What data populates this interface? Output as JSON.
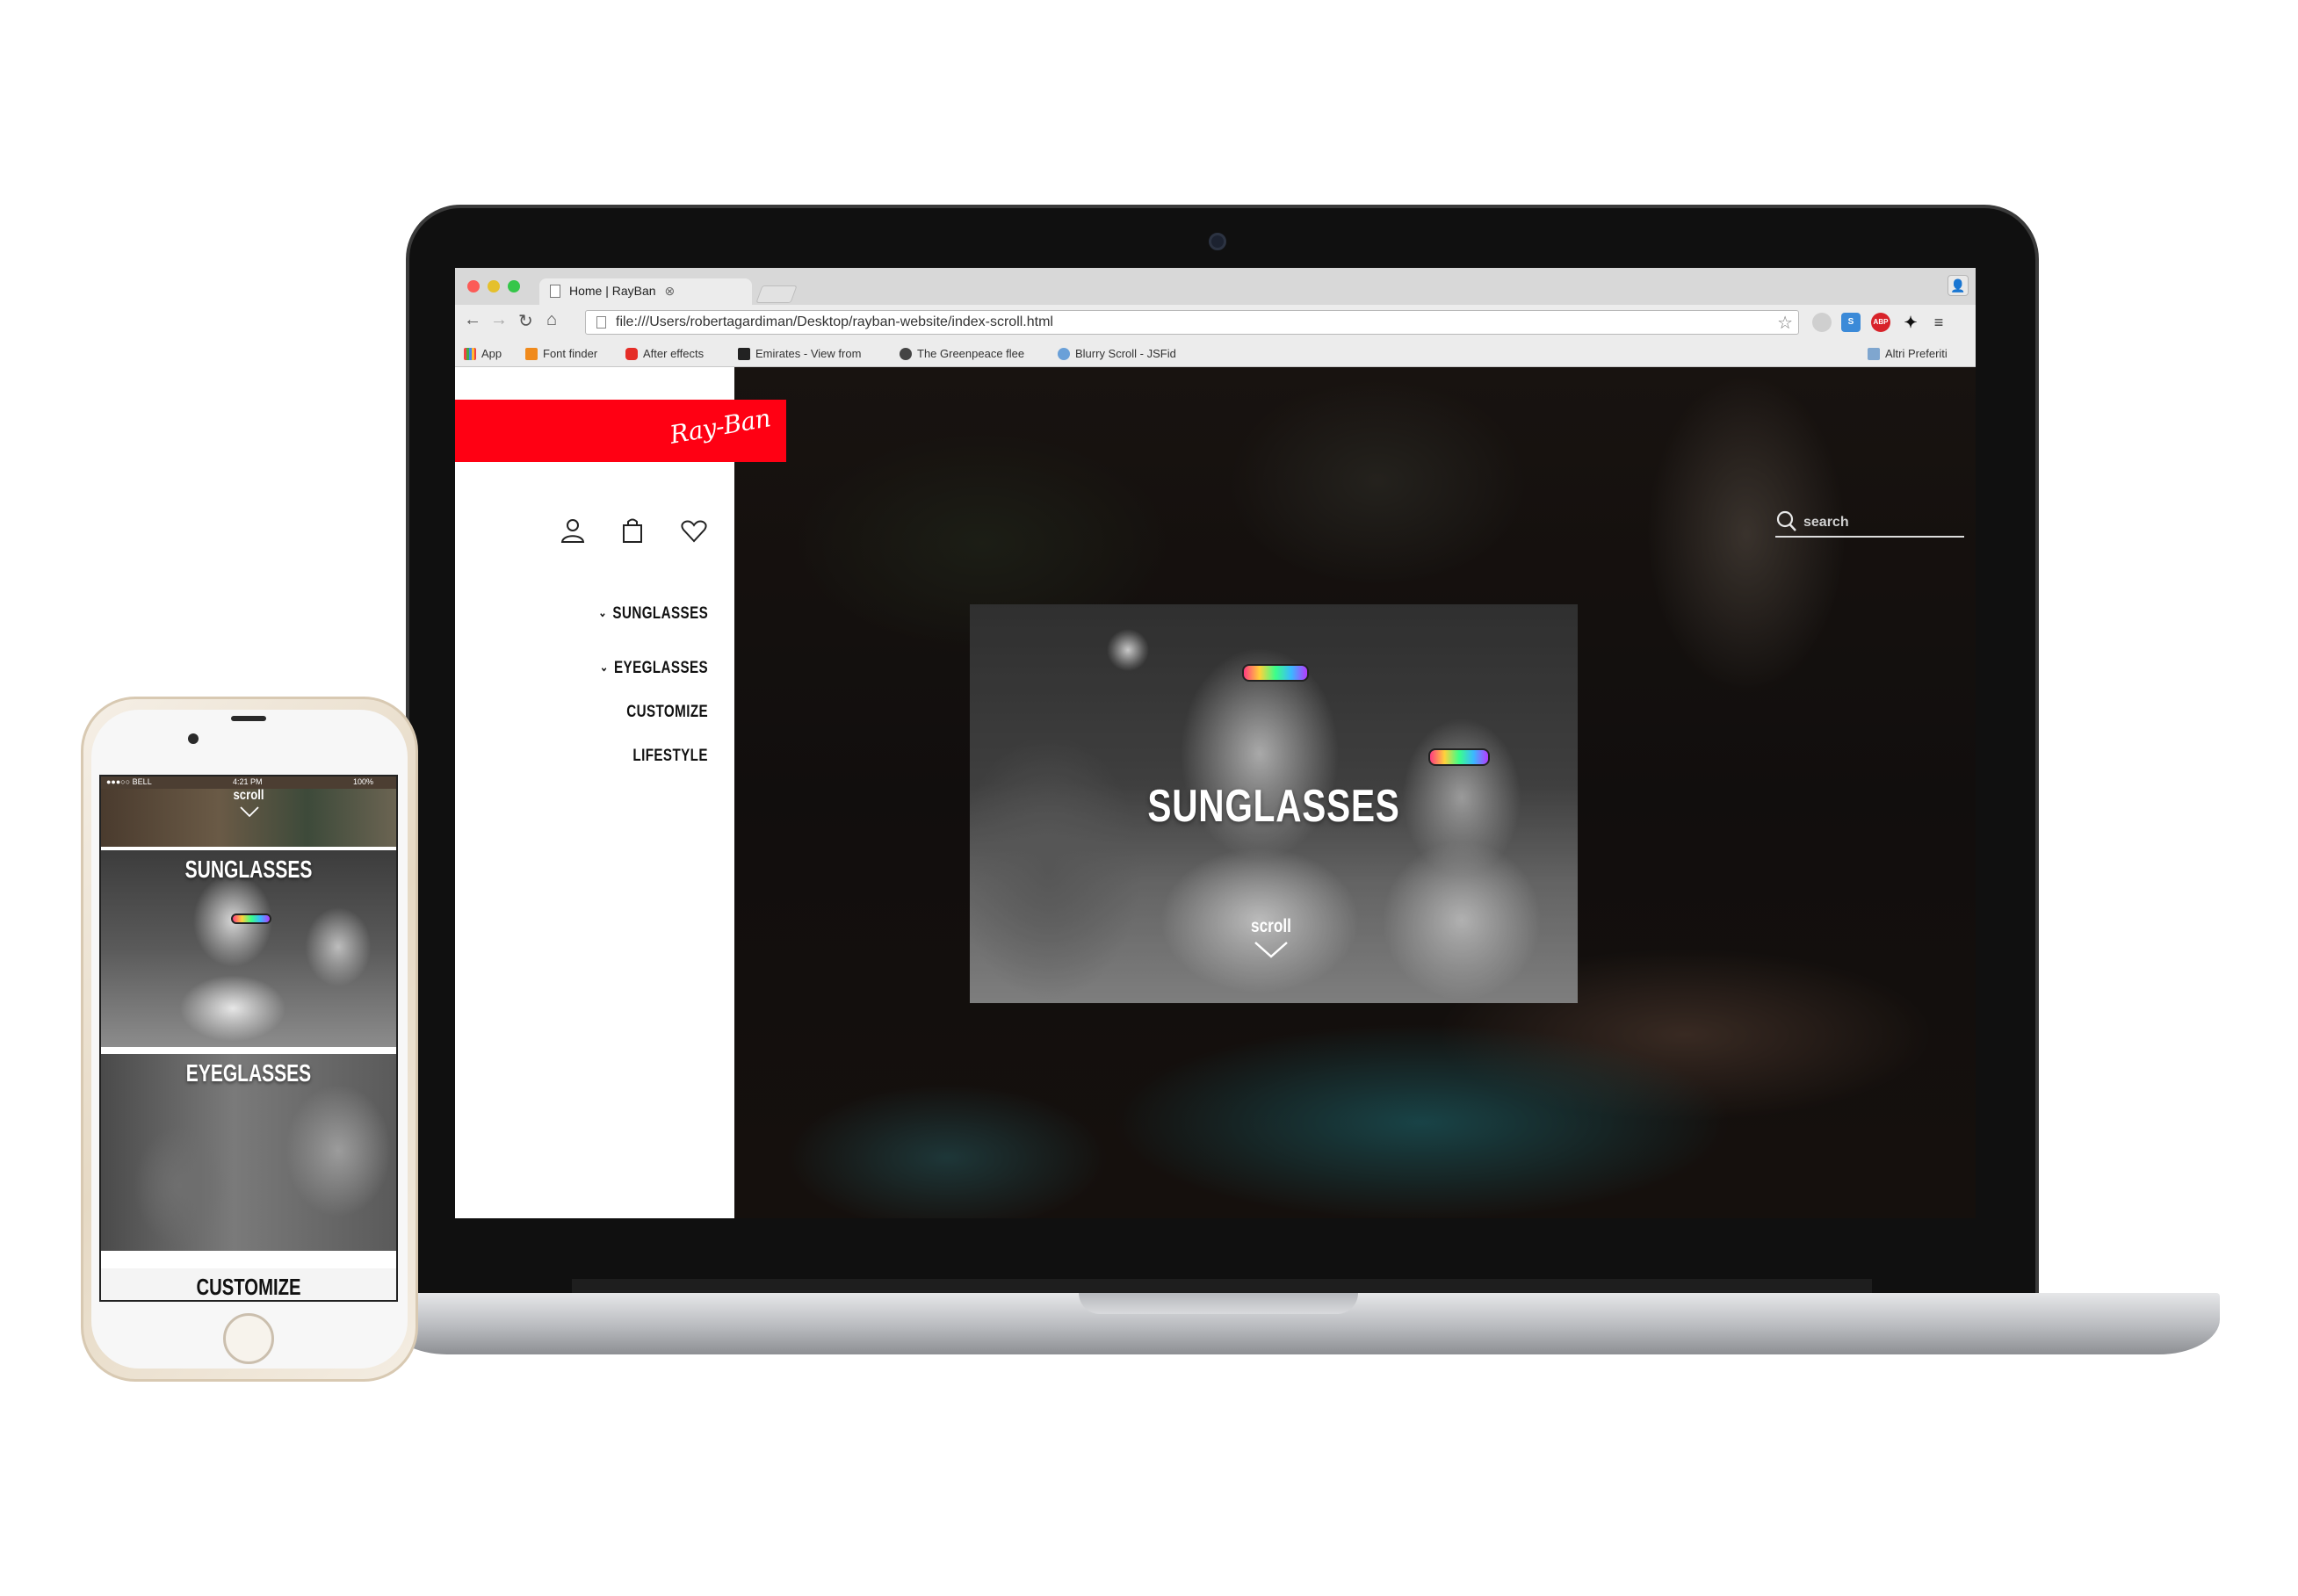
{
  "browser": {
    "tab_title": "Home | RayBan",
    "url": "file:///Users/robertagardiman/Desktop/rayban-website/index-scroll.html",
    "bookmarks": [
      {
        "label": "App",
        "icon": "apps-grid-icon"
      },
      {
        "label": "Font finder",
        "icon": "font-finder-icon"
      },
      {
        "label": "After effects",
        "icon": "youtube-icon"
      },
      {
        "label": "Emirates - View from",
        "icon": "photo-icon"
      },
      {
        "label": "The Greenpeace flee",
        "icon": "greenpeace-icon"
      },
      {
        "label": "Blurry Scroll - JSFid",
        "icon": "jsfiddle-icon"
      }
    ],
    "other_bookmarks": "Altri Preferiti",
    "extensions": [
      {
        "name": "circle-extension-icon",
        "label": ""
      },
      {
        "name": "s-extension-icon",
        "label": "S"
      },
      {
        "name": "adblock-plus-icon",
        "label": "ABP"
      },
      {
        "name": "ninja-extension-icon",
        "label": ""
      }
    ]
  },
  "site": {
    "brand": "Ray-Ban",
    "brand_color": "#ff0013",
    "account_icons": [
      "user-icon",
      "shopping-bag-icon",
      "heart-icon"
    ],
    "nav": [
      {
        "label": "SUNGLASSES",
        "has_dropdown": true
      },
      {
        "label": "EYEGLASSES",
        "has_dropdown": true
      },
      {
        "label": "CUSTOMIZE",
        "has_dropdown": false
      },
      {
        "label": "LIFESTYLE",
        "has_dropdown": false
      }
    ],
    "search": {
      "placeholder": "search",
      "value": ""
    },
    "hero": {
      "title": "SUNGLASSES"
    },
    "scroll_label": "scroll"
  },
  "mobile": {
    "status": {
      "carrier": "●●●○○ BELL",
      "time": "4:21 PM",
      "battery": "100%"
    },
    "scroll_label": "scroll",
    "cards": [
      {
        "title": "SUNGLASSES"
      },
      {
        "title": "EYEGLASSES"
      }
    ],
    "customize_label": "CUSTOMIZE"
  }
}
